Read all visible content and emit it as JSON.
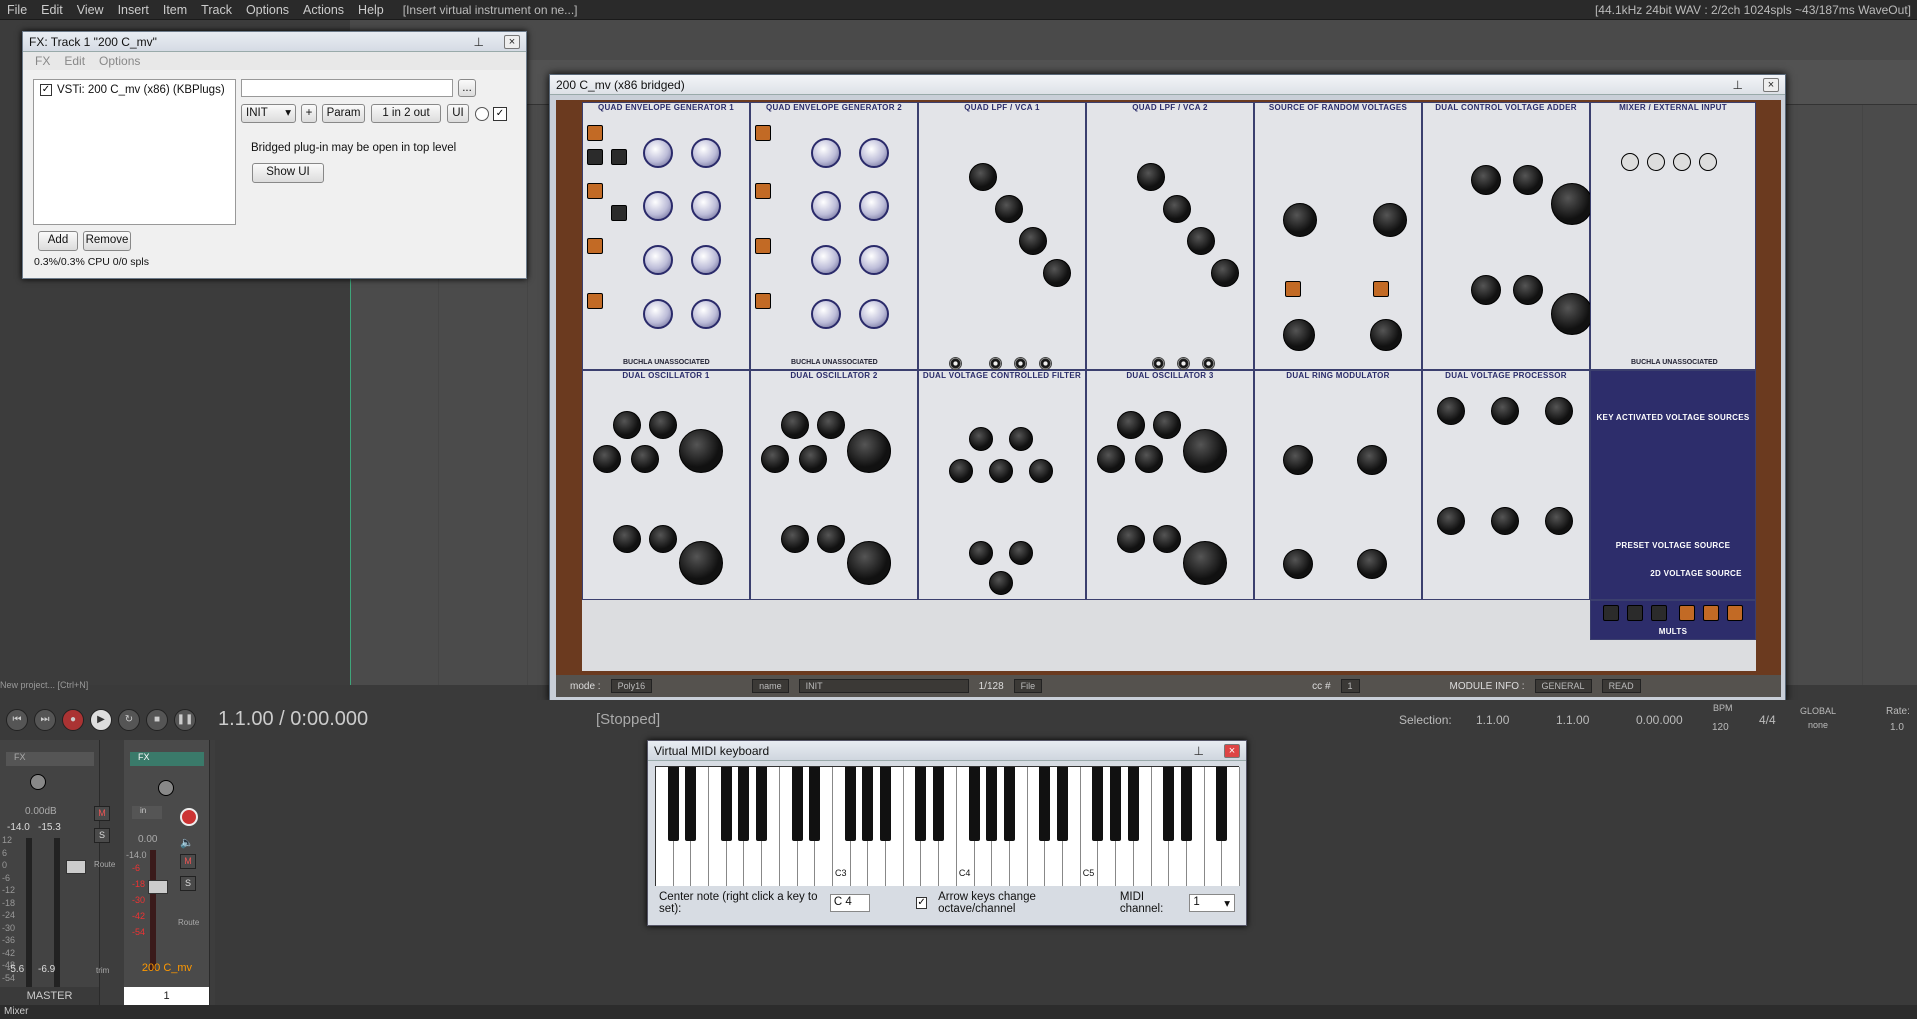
{
  "menubar": {
    "items": [
      "File",
      "Edit",
      "View",
      "Insert",
      "Item",
      "Track",
      "Options",
      "Actions",
      "Help"
    ],
    "hint": "[Insert virtual instrument on ne...]",
    "status": "[44.1kHz 24bit WAV : 2/2ch 1024spls ~43/187ms WaveOut]"
  },
  "fxwindow": {
    "title": "FX: Track 1 \"200 C_mv\"",
    "submenu": [
      "FX",
      "Edit",
      "Options"
    ],
    "fx_item": "VSTi: 200 C_mv (x86) (KBPlugs)",
    "preset": "INIT",
    "plus_label": "+",
    "param_label": "Param",
    "io_label": "1 in 2 out",
    "ui_label": "UI",
    "more_label": "...",
    "bridged_msg": "Bridged plug-in may be open in top level",
    "show_ui_label": "Show UI",
    "add_label": "Add",
    "remove_label": "Remove",
    "cpu": "0.3%/0.3% CPU 0/0 spls"
  },
  "plugin": {
    "title": "200 C_mv (x86 bridged)",
    "modules_top": [
      {
        "name": "QUAD ENVELOPE GENERATOR 1"
      },
      {
        "name": "QUAD ENVELOPE GENERATOR 2"
      },
      {
        "name": "QUAD LPF / VCA 1"
      },
      {
        "name": "QUAD LPF / VCA 2"
      },
      {
        "name": "SOURCE OF RANDOM VOLTAGES"
      },
      {
        "name": "DUAL CONTROL VOLTAGE ADDER"
      },
      {
        "name": "MIXER / EXTERNAL INPUT"
      }
    ],
    "modules_bottom": [
      {
        "name": "DUAL OSCILLATOR 1"
      },
      {
        "name": "DUAL OSCILLATOR 2"
      },
      {
        "name": "DUAL VOLTAGE CONTROLLED FILTER"
      },
      {
        "name": "DUAL OSCILLATOR 3"
      },
      {
        "name": "DUAL RING MODULATOR"
      },
      {
        "name": "DUAL VOLTAGE PROCESSOR"
      },
      {
        "name": "KEY ACTIVATED VOLTAGE SOURCES"
      }
    ],
    "bank_label": "BUCHLA UNASSOCIATED",
    "preset_src": "PRESET VOLTAGE SOURCE",
    "twod": "2D VOLTAGE SOURCE",
    "mults": "MULTS",
    "status": {
      "mode_label": "mode :",
      "mode_value": "Poly16",
      "name": "name",
      "preset": "INIT",
      "count": "1/128",
      "file": "File",
      "cc_label": "cc #",
      "cc_value": "1",
      "module_info": "MODULE INFO :",
      "general": "GENERAL",
      "read": "READ"
    }
  },
  "transport": {
    "position": "1.1.00 / 0:00.000",
    "state": "[Stopped]",
    "selection_label": "Selection:",
    "sel_start": "1.1.00",
    "sel_end": "1.1.00",
    "sel_len": "0.00.000",
    "bpm_label": "BPM",
    "bpm": "120",
    "timesig": "4/4",
    "global_label": "GLOBAL",
    "global_value": "none",
    "rate_label": "Rate:",
    "rate": "1.0"
  },
  "project": "New project... [Ctrl+N]",
  "mixer": {
    "master_label": "MASTER",
    "master_fx": "FX",
    "master_db": "0.00dB",
    "master_peak_l": "-14.0",
    "master_peak_r": "-15.3",
    "master_bottom_l": "-5.6",
    "master_bottom_r": "-6.9",
    "track_fx": "FX",
    "track_db": "0.00",
    "track_name": "200 C_mv",
    "track_num": "1",
    "track_in": "in",
    "route": "Route",
    "trim": "trim",
    "m": "M",
    "s": "S",
    "scale": [
      "12",
      "6",
      "0",
      "-6",
      "-12",
      "-18",
      "-24",
      "-30",
      "-36",
      "-42",
      "-48",
      "-54"
    ],
    "track_peak": "-14.0",
    "track_scale": [
      "-6",
      "-18",
      "-30",
      "-42",
      "-54"
    ],
    "tab": "Mixer"
  },
  "midi": {
    "title": "Virtual MIDI keyboard",
    "center_note_label": "Center note (right click a key to set):",
    "center_note": "C 4",
    "arrow_keys_label": "Arrow keys change octave/channel",
    "channel_label": "MIDI channel:",
    "channel": "1",
    "octave_labels": [
      "C3",
      "C4",
      "C5"
    ]
  },
  "colors": {
    "accent": "#2d2d6b",
    "wood": "#6b3a1f",
    "record": "#aa3333"
  }
}
